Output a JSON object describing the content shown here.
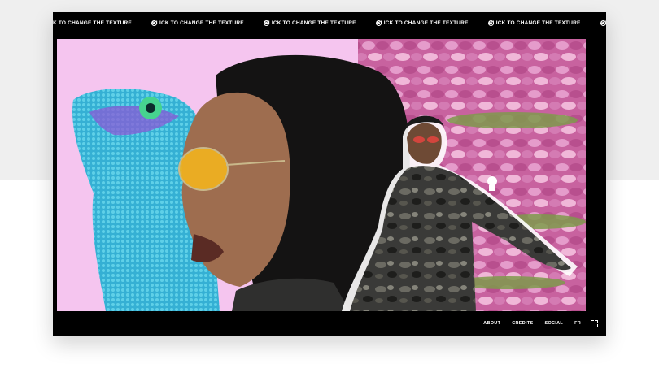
{
  "ticker": {
    "label": "CLICK TO CHANGE THE TEXTURE",
    "repeat": 7,
    "icon": "smiley-icon"
  },
  "nav": {
    "about": "ABOUT",
    "credits": "CREDITS",
    "social": "SOCIAL",
    "lang": "FR",
    "fullscreen_icon": "fullscreen-icon"
  },
  "colors": {
    "frame": "#000000",
    "scene_pink": "#f5c5ef",
    "flower_pink": "#d87ab8",
    "lizard_blue": "#3ab6d6",
    "lens_yellow": "#f2b21e"
  }
}
